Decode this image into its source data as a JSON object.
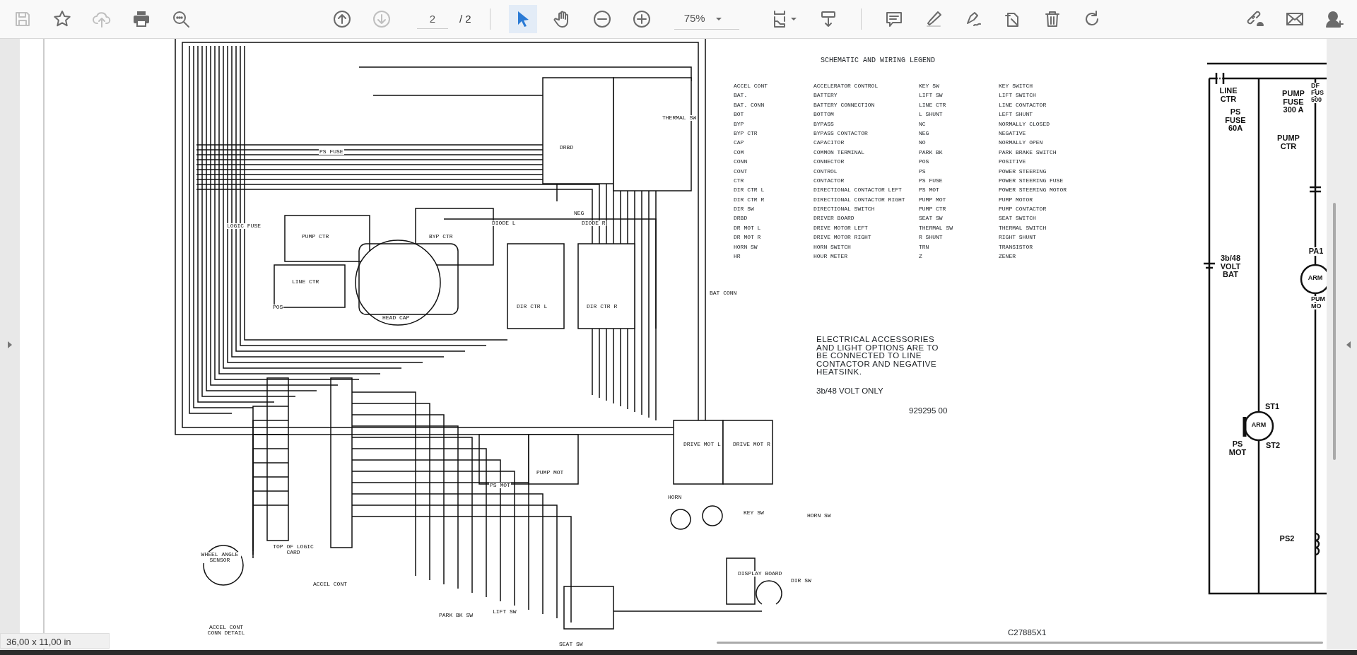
{
  "toolbar": {
    "file_buttons": [
      {
        "disabled": true
      },
      {
        "disabled": false
      },
      {
        "disabled": true
      },
      {
        "disabled": false
      },
      {
        "disabled": false
      }
    ],
    "page_buttons": [
      {
        "disabled": false
      },
      {
        "disabled": true
      }
    ],
    "page_field": {
      "value": "2"
    },
    "page_total": "/ 2",
    "tools": [
      {
        "selected": true
      },
      {
        "selected": false
      }
    ],
    "zoom_field": {
      "value": "75%"
    },
    "edit_buttons": [
      {
        "disabled": false
      },
      {
        "disabled": false
      },
      {
        "disabled": false
      },
      {
        "disabled": false
      },
      {
        "disabled": false
      },
      {
        "disabled": false
      },
      {
        "disabled": false
      },
      {
        "disabled": false
      }
    ],
    "share_buttons": [
      {
        "disabled": false
      },
      {
        "disabled": false
      },
      {
        "disabled": false
      }
    ]
  },
  "document": {
    "legend": {
      "title": "SCHEMATIC AND WIRING LEGEND",
      "items": [
        {
          "abbr": "ACCEL CONT",
          "meaning": "ACCELERATOR CONTROL"
        },
        {
          "abbr": "BAT.",
          "meaning": "BATTERY"
        },
        {
          "abbr": "BAT. CONN",
          "meaning": "BATTERY CONNECTION"
        },
        {
          "abbr": "BOT",
          "meaning": "BOTTOM"
        },
        {
          "abbr": "BYP",
          "meaning": "BYPASS"
        },
        {
          "abbr": "BYP CTR",
          "meaning": "BYPASS CONTACTOR"
        },
        {
          "abbr": "CAP",
          "meaning": "CAPACITOR"
        },
        {
          "abbr": "COM",
          "meaning": "COMMON TERMINAL"
        },
        {
          "abbr": "CONN",
          "meaning": "CONNECTOR"
        },
        {
          "abbr": "CONT",
          "meaning": "CONTROL"
        },
        {
          "abbr": "CTR",
          "meaning": "CONTACTOR"
        },
        {
          "abbr": "DIR CTR L",
          "meaning": "DIRECTIONAL CONTACTOR LEFT"
        },
        {
          "abbr": "DIR CTR R",
          "meaning": "DIRECTIONAL CONTACTOR RIGHT"
        },
        {
          "abbr": "DIR SW",
          "meaning": "DIRECTIONAL SWITCH"
        },
        {
          "abbr": "DRBD",
          "meaning": "DRIVER BOARD"
        },
        {
          "abbr": "DR MOT L",
          "meaning": "DRIVE MOTOR LEFT"
        },
        {
          "abbr": "DR MOT R",
          "meaning": "DRIVE MOTOR RIGHT"
        },
        {
          "abbr": "HORN SW",
          "meaning": "HORN SWITCH"
        },
        {
          "abbr": "HR",
          "meaning": "HOUR METER"
        },
        {
          "abbr": "KEY SW",
          "meaning": "KEY SWITCH"
        },
        {
          "abbr": "LIFT SW",
          "meaning": "LIFT SWITCH"
        },
        {
          "abbr": "LINE CTR",
          "meaning": "LINE CONTACTOR"
        },
        {
          "abbr": "L SHUNT",
          "meaning": "LEFT SHUNT"
        },
        {
          "abbr": "NC",
          "meaning": "NORMALLY CLOSED"
        },
        {
          "abbr": "NEG",
          "meaning": "NEGATIVE"
        },
        {
          "abbr": "NO",
          "meaning": "NORMALLY OPEN"
        },
        {
          "abbr": "PARK BK",
          "meaning": "PARK BRAKE SWITCH"
        },
        {
          "abbr": "POS",
          "meaning": "POSITIVE"
        },
        {
          "abbr": "PS",
          "meaning": "POWER STEERING"
        },
        {
          "abbr": "PS FUSE",
          "meaning": "POWER STEERING FUSE"
        },
        {
          "abbr": "PS MOT",
          "meaning": "POWER STEERING MOTOR"
        },
        {
          "abbr": "PUMP MOT",
          "meaning": "PUMP MOTOR"
        },
        {
          "abbr": "PUMP CTR",
          "meaning": "PUMP CONTACTOR"
        },
        {
          "abbr": "SEAT SW",
          "meaning": "SEAT SWITCH"
        },
        {
          "abbr": "THERMAL SW",
          "meaning": "THERMAL SWITCH"
        },
        {
          "abbr": "R SHUNT",
          "meaning": "RIGHT SHUNT"
        },
        {
          "abbr": "TRN",
          "meaning": "TRANSISTOR"
        },
        {
          "abbr": "Z",
          "meaning": "ZENER"
        }
      ]
    },
    "note": "ELECTRICAL ACCESSORIES AND LIGHT OPTIONS ARE TO BE CONNECTED TO LINE CONTACTOR AND NEGATIVE HEATSINK.",
    "voltage_note": "3b/48 VOLT ONLY",
    "part_number": "929295 00",
    "drawing_number": "C27885X1",
    "wiring_labels": [
      "PS FUSE",
      "DRBD",
      "THERMAL SW",
      "LOGIC FUSE",
      "PUMP CTR",
      "BYP CTR",
      "LINE CTR",
      "POS",
      "HEAD CAP",
      "DIR CTR L",
      "DIR CTR R",
      "NEG",
      "BAT CONN",
      "DIODE L",
      "DIODE R",
      "DRIVE MOT L",
      "DRIVE MOT R",
      "PS MOT",
      "PUMP MOT",
      "HORN",
      "KEY SW",
      "HORN SW",
      "WHEEL ANGLE SENSOR",
      "TOP OF LOGIC CARD",
      "ACCEL CONT",
      "PARK BK SW",
      "LIFT SW",
      "SEAT SW",
      "DISPLAY BOARD",
      "DIR SW",
      "ACCEL CONT CONN DETAIL"
    ],
    "schematic_labels": [
      "LINE CTR",
      "PS FUSE 60A",
      "PUMP FUSE 300 A",
      "DF",
      "FUS",
      "500",
      "PUMP CTR",
      "PA1",
      "ARM",
      "PUM",
      "MO",
      "3b/48 VOLT BAT",
      "ST1",
      "ARM",
      "PS MOT",
      "ST2",
      "PS2"
    ]
  },
  "status_bar": {
    "page_size": "36,00 x 11,00 in"
  }
}
